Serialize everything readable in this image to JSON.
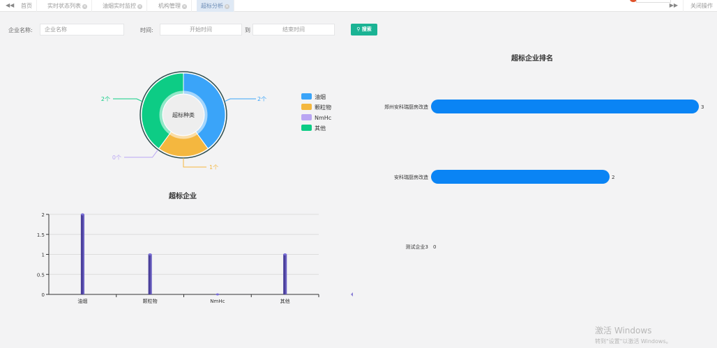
{
  "tabs": {
    "items": [
      {
        "label": "首页",
        "closable": false,
        "active": false
      },
      {
        "label": "实时状态列表",
        "closable": true,
        "active": false
      },
      {
        "label": "油烟实时监控",
        "closable": true,
        "active": false
      },
      {
        "label": "机构管理",
        "closable": true,
        "active": false
      },
      {
        "label": "超标分析",
        "closable": true,
        "active": true
      }
    ],
    "close_action": "关闭操作",
    "nav_left": "◀◀",
    "nav_right": "▶▶"
  },
  "search": {
    "company_label": "企业名称:",
    "company_placeholder": "企业名称",
    "time_label": "时间:",
    "start_placeholder": "开始时间",
    "to_label": "到",
    "end_placeholder": "结束时间",
    "search_button": "搜索"
  },
  "pie_chart": {
    "center_label": "超标种类",
    "chart_data": {
      "type": "pie",
      "donut": true,
      "categories": [
        "油烟",
        "颗粒物",
        "NmHc",
        "其他"
      ],
      "values": [
        2,
        1,
        0,
        2
      ],
      "colors": [
        "#3aa4f9",
        "#f4b73f",
        "#b9a6f3",
        "#0dcc85"
      ],
      "slice_labels": [
        "2个",
        "1个",
        "0个",
        "2个"
      ],
      "legend_position": "right"
    }
  },
  "bar_chart": {
    "title": "超标企业",
    "chart_data": {
      "type": "bar",
      "categories": [
        "油烟",
        "颗粒物",
        "NmHc",
        "其他"
      ],
      "values": [
        2,
        1,
        0,
        1
      ],
      "ylim": [
        0,
        2
      ],
      "yticks": [
        "0",
        "0.5",
        "1",
        "1.5",
        "2"
      ],
      "color": "#4a3f9a",
      "grid": true
    }
  },
  "ranking_chart": {
    "title": "超标企业排名",
    "chart_data": {
      "type": "bar",
      "orientation": "horizontal",
      "categories": [
        "郑州安科瑞厨房改造",
        "安科瑞厨房改造",
        "测试企业3"
      ],
      "values": [
        3,
        2,
        0
      ],
      "value_labels": [
        "3",
        "2",
        "0"
      ],
      "color": "#0a84f4"
    }
  },
  "watermark": {
    "line1": "激活 Windows",
    "line2": "转到\"设置\"以激活 Windows。"
  }
}
